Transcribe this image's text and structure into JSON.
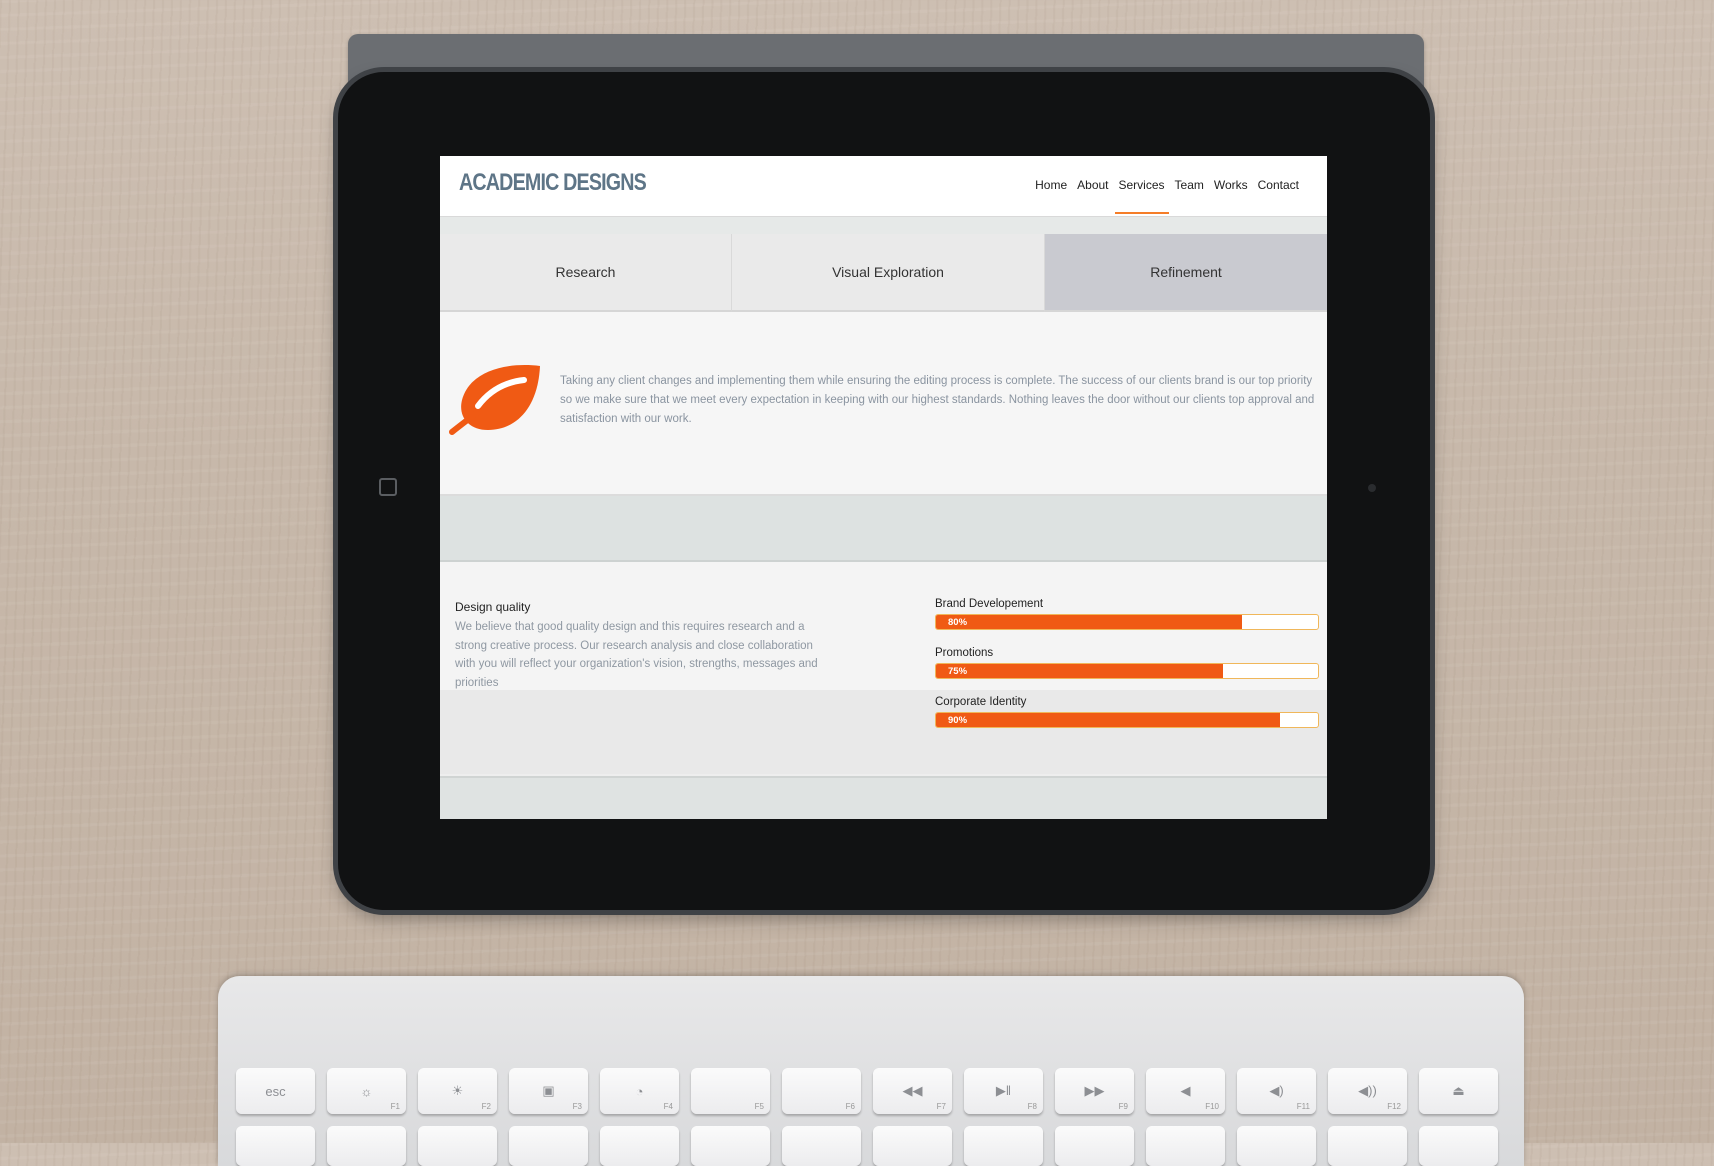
{
  "header": {
    "logo": "ACADEMIC DESIGNS",
    "nav": [
      {
        "label": "Home"
      },
      {
        "label": "About"
      },
      {
        "label": "Services",
        "active": true
      },
      {
        "label": "Team"
      },
      {
        "label": "Works"
      },
      {
        "label": "Contact"
      }
    ]
  },
  "tabs": [
    {
      "label": "Research"
    },
    {
      "label": "Visual Exploration"
    },
    {
      "label": "Refinement",
      "active": true
    }
  ],
  "panel": {
    "icon": "leaf-icon",
    "text": "Taking any client changes and implementing them while ensuring the editing process is complete. The success of our clients brand is our top priority so we make sure that we meet every expectation in keeping with our highest standards. Nothing leaves the door without our clients top approval and satisfaction with our work."
  },
  "quality": {
    "title": "Design quality",
    "text": "We believe that good quality design and this requires research and a strong creative process. Our research analysis and close collaboration with you will reflect your organization's vision, strengths, messages and priorities"
  },
  "skills": [
    {
      "label": "Brand Developement",
      "percent": 80,
      "percent_label": "80%"
    },
    {
      "label": "Promotions",
      "percent": 75,
      "percent_label": "75%"
    },
    {
      "label": "Corporate Identity",
      "percent": 90,
      "percent_label": "90%"
    }
  ],
  "colors": {
    "accent": "#f05a14",
    "logo": "#5e7587"
  },
  "keyboard": {
    "keys": [
      {
        "label": "esc",
        "fn": ""
      },
      {
        "label": "☼",
        "fn": "F1"
      },
      {
        "label": "☀",
        "fn": "F2"
      },
      {
        "label": "▣",
        "fn": "F3"
      },
      {
        "label": "◔",
        "fn": "F4"
      },
      {
        "label": "",
        "fn": "F5"
      },
      {
        "label": "",
        "fn": "F6"
      },
      {
        "label": "◀◀",
        "fn": "F7"
      },
      {
        "label": "▶‖",
        "fn": "F8"
      },
      {
        "label": "▶▶",
        "fn": "F9"
      },
      {
        "label": "◀",
        "fn": "F10"
      },
      {
        "label": "◀)",
        "fn": "F11"
      },
      {
        "label": "◀))",
        "fn": "F12"
      },
      {
        "label": "⏏",
        "fn": ""
      }
    ]
  }
}
